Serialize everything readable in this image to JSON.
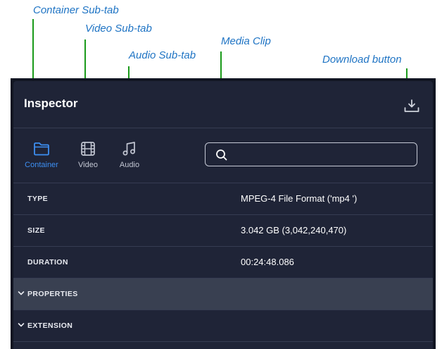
{
  "callouts": {
    "container": "Container Sub-tab",
    "video": "Video Sub-tab",
    "audio": "Audio Sub-tab",
    "media": "Media Clip",
    "download": "Download button"
  },
  "inspector": {
    "title": "Inspector",
    "tabs": [
      {
        "label": "Container",
        "icon": "folder-icon",
        "active": true
      },
      {
        "label": "Video",
        "icon": "film-icon",
        "active": false
      },
      {
        "label": "Audio",
        "icon": "music-note-icon",
        "active": false
      }
    ],
    "search": {
      "value": "",
      "placeholder": ""
    },
    "rows": [
      {
        "key": "TYPE",
        "value": "MPEG-4 File Format ('mp4 ')"
      },
      {
        "key": "SIZE",
        "value": "3.042 GB (3,042,240,470)"
      },
      {
        "key": "DURATION",
        "value": "00:24:48.086"
      }
    ],
    "sections": [
      {
        "label": "PROPERTIES",
        "expanded": true
      },
      {
        "label": "EXTENSION",
        "expanded": true
      }
    ]
  },
  "colors": {
    "accent": "#3d8ff2",
    "callout_text": "#1f74c4",
    "leader_line": "#1a9a1a",
    "panel_bg": "#1f2437"
  }
}
